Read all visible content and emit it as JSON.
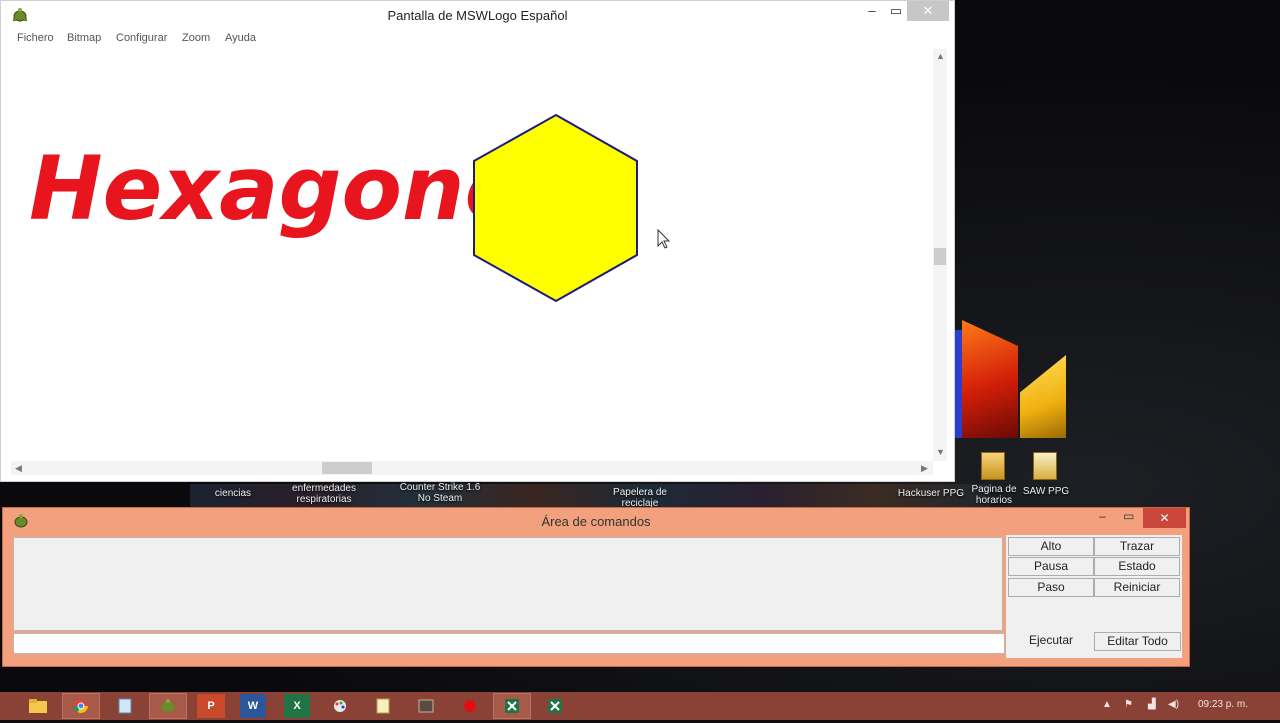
{
  "main_window": {
    "title": "Pantalla de MSWLogo Español",
    "controls": {
      "minimize": "–",
      "maximize": "▭",
      "close": "✕"
    },
    "menu": [
      "Fichero",
      "Bitmap",
      "Configurar",
      "Zoom",
      "Ayuda"
    ],
    "canvas": {
      "text": "Hexagono",
      "text_color": "#e8141e",
      "hexagon_fill": "#ffff00",
      "hexagon_stroke": "#1a1a8a"
    }
  },
  "command_window": {
    "title": "Área de comandos",
    "controls": {
      "minimize": "–",
      "maximize": "▭",
      "close": "✕"
    },
    "history_text": "",
    "input_value": "",
    "buttons": {
      "alto": "Alto",
      "trazar": "Trazar",
      "pausa": "Pausa",
      "estado": "Estado",
      "paso": "Paso",
      "reiniciar": "Reiniciar",
      "ejecutar": "Ejecutar",
      "editar_todo": "Editar Todo"
    }
  },
  "desktop": {
    "labels": {
      "ciencias": "ciencias",
      "enfermedades": "enfermedades respiratorias",
      "counter_strike": "Counter Strike 1.6 No Steam",
      "papelera": "Papelera de reciclaje",
      "hackuser": "Hackuser PPG",
      "pagina": "Pagina de horarios",
      "saw": "SAW PPG"
    }
  },
  "taskbar": {
    "apps": [
      "file-explorer",
      "chrome",
      "notepad",
      "mswlogo",
      "powerpoint",
      "word",
      "excel",
      "paint",
      "notes",
      "media",
      "record",
      "excel-2",
      "excel-3"
    ],
    "clock": "09:23 p. m.",
    "tray_icons": [
      "chevron-up-icon",
      "flag-icon",
      "network-icon",
      "volume-icon"
    ]
  }
}
